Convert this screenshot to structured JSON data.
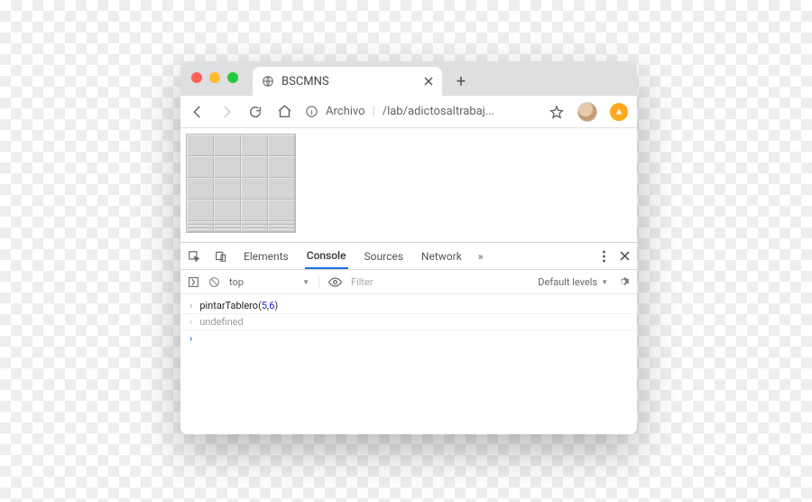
{
  "window": {
    "tab_title": "BSCMNS",
    "omnibox_prefix": "Archivo",
    "omnibox_path": "/lab/adictosaltrabaj...",
    "new_tab_tooltip": "+"
  },
  "devtools": {
    "tabs": [
      "Elements",
      "Console",
      "Sources",
      "Network"
    ],
    "active_tab": "Console",
    "more_glyph": "»",
    "context_selector": "top",
    "filter_placeholder": "Filter",
    "levels_label": "Default levels",
    "console_lines": [
      {
        "kind": "input",
        "text": "pintarTablero(5,6)",
        "fn": "pintarTablero",
        "args": [
          5,
          6
        ]
      },
      {
        "kind": "output",
        "text": "undefined"
      }
    ]
  },
  "board": {
    "cols": 4,
    "full_rows": 4,
    "thin_rows": 3
  }
}
